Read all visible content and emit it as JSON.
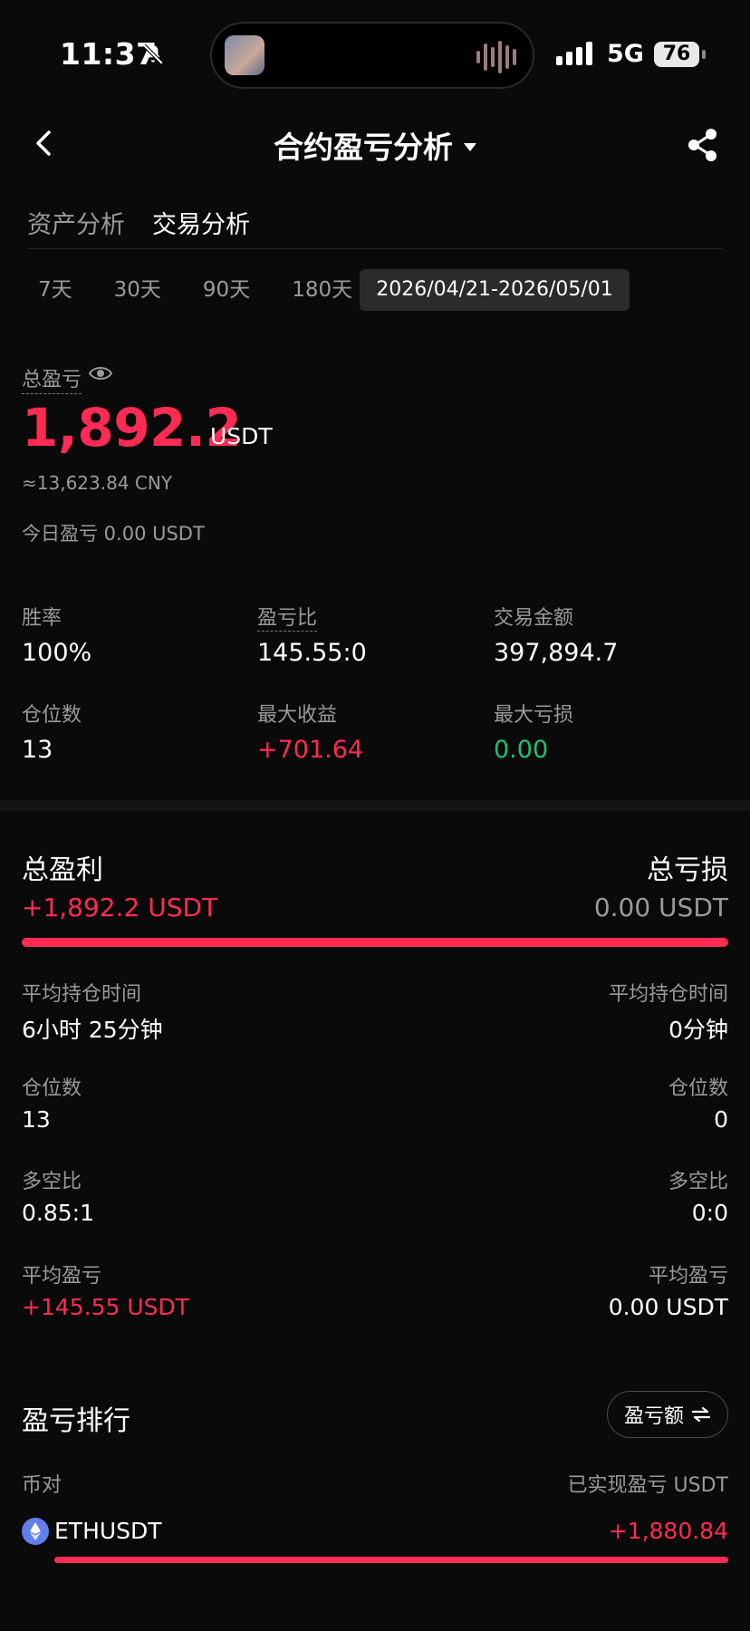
{
  "status_bar": {
    "time": "11:37",
    "network": "5G",
    "battery": "76"
  },
  "header": {
    "title": "合约盈亏分析"
  },
  "tabs": [
    {
      "label": "资产分析",
      "active": false
    },
    {
      "label": "交易分析",
      "active": true
    }
  ],
  "periods": [
    "7天",
    "30天",
    "90天",
    "180天"
  ],
  "date_range": "2026/04/21-2026/05/01",
  "summary": {
    "total_label": "总盈亏",
    "total_value": "1,892.2",
    "total_unit": "USDT",
    "cny": "≈13,623.84 CNY",
    "today": "今日盈亏 0.00 USDT"
  },
  "stats": [
    {
      "label": "胜率",
      "value": "100%"
    },
    {
      "label": "盈亏比",
      "value": "145.55:0"
    },
    {
      "label": "交易金额",
      "value": "397,894.7"
    },
    {
      "label": "仓位数",
      "value": "13"
    },
    {
      "label": "最大收益",
      "value": "+701.64"
    },
    {
      "label": "最大亏损",
      "value": "0.00"
    }
  ],
  "profit_loss": {
    "profit_label": "总盈利",
    "profit_value": "+1,892.2 USDT",
    "loss_label": "总亏损",
    "loss_value": "0.00 USDT",
    "profit_share": 1.0,
    "rows": [
      {
        "label_left": "平均持仓时间",
        "value_left": "6小时 25分钟",
        "label_right": "平均持仓时间",
        "value_right": "0分钟"
      },
      {
        "label_left": "仓位数",
        "value_left": "13",
        "label_right": "仓位数",
        "value_right": "0"
      },
      {
        "label_left": "多空比",
        "value_left": "0.85:1",
        "label_right": "多空比",
        "value_right": "0:0"
      },
      {
        "label_left": "平均盈亏",
        "value_left": "+145.55 USDT",
        "label_right": "平均盈亏",
        "value_right": "0.00 USDT"
      }
    ]
  },
  "ranking": {
    "title": "盈亏排行",
    "button_label": "盈亏额",
    "col_pair": "币对",
    "col_pnl": "已实现盈亏 USDT",
    "items": [
      {
        "symbol": "ETHUSDT",
        "value": "+1,880.84",
        "share": 1.0
      }
    ]
  },
  "colors": {
    "profit": "#ff2b55",
    "loss": "#1fbf75",
    "background": "#0a0a0a"
  }
}
